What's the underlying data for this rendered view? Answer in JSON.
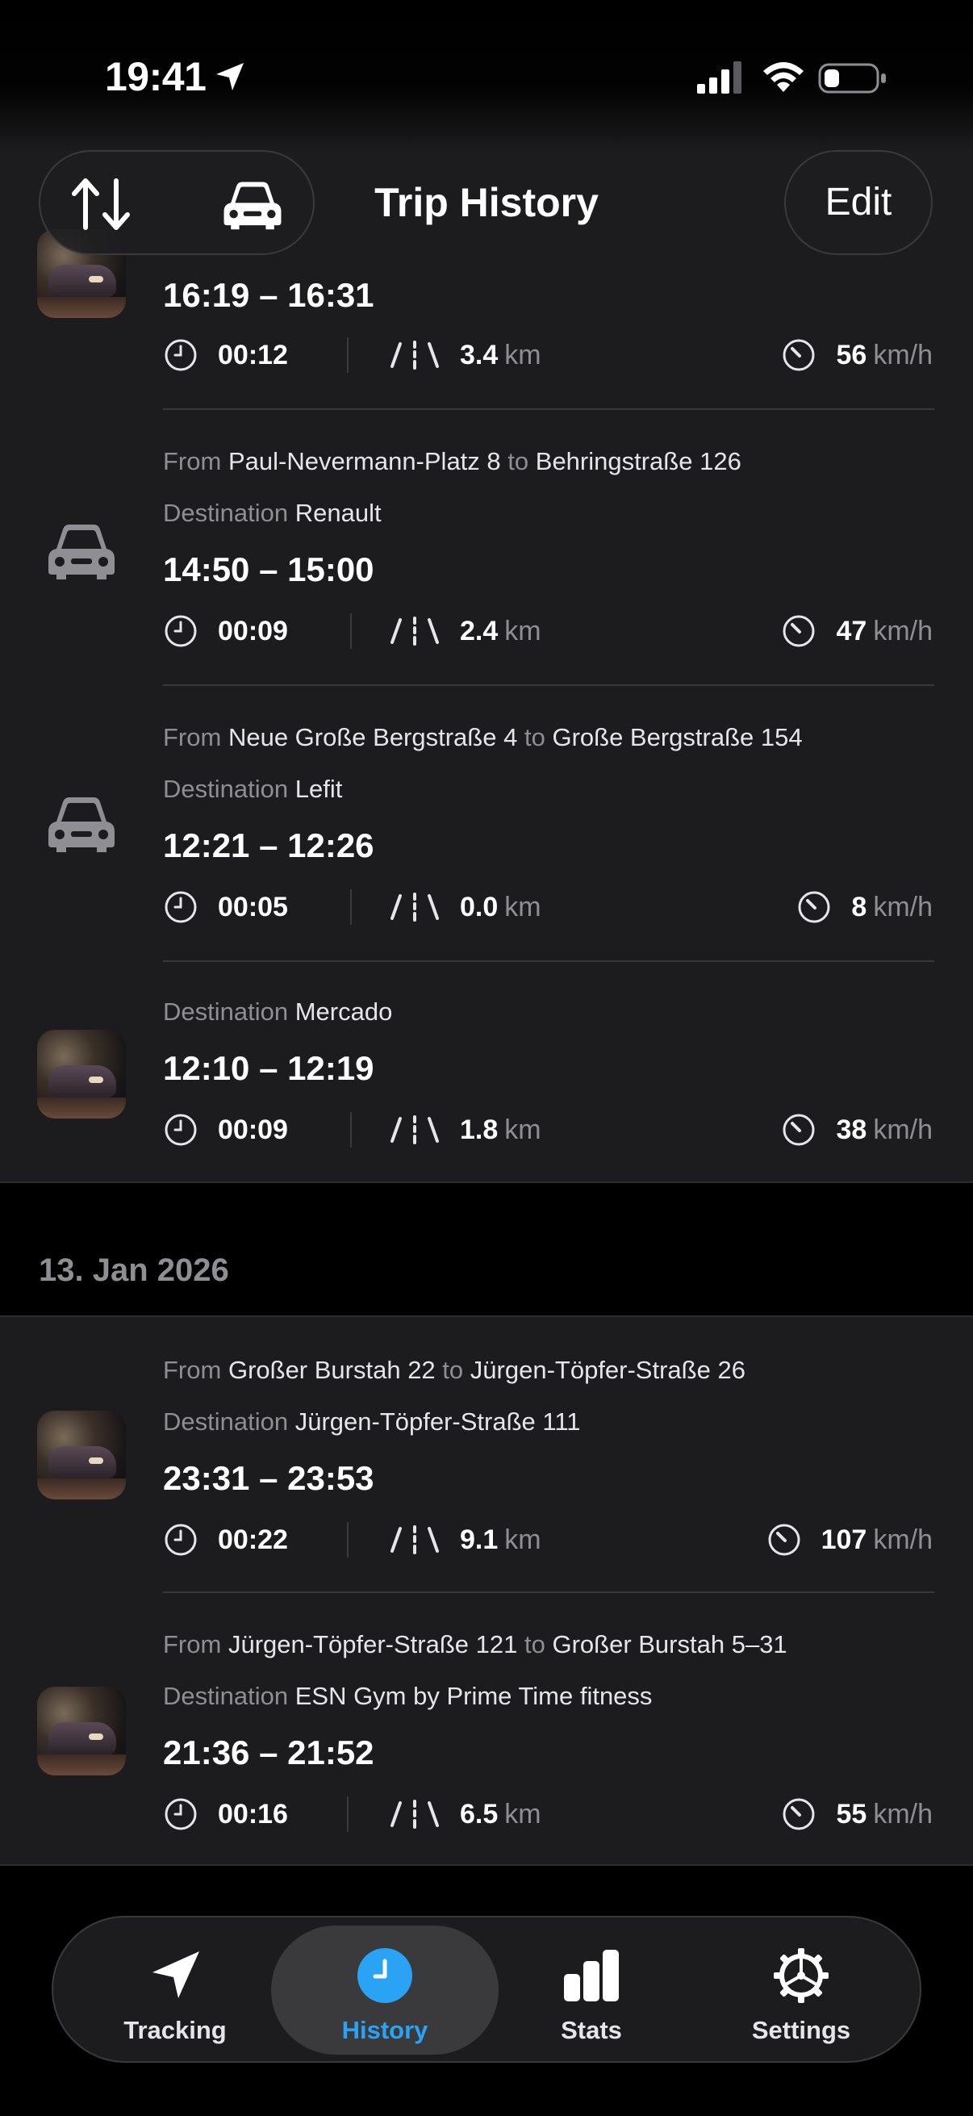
{
  "status_bar": {
    "time": "19:41"
  },
  "nav": {
    "title": "Trip History",
    "edit_label": "Edit"
  },
  "trips_section1": [
    {
      "icon": "car-photo",
      "time": "16:19 – 16:31",
      "duration": "00:12",
      "distance": "3.4",
      "distance_unit": "km",
      "speed": "56",
      "speed_unit": "km/h"
    },
    {
      "icon": "car-icon",
      "from_label": "From",
      "from": "Paul-Nevermann-Platz 8",
      "to_label": "to",
      "to": "Behringstraße 126",
      "dest_label": "Destination",
      "destination": "Renault",
      "time": "14:50 – 15:00",
      "duration": "00:09",
      "distance": "2.4",
      "distance_unit": "km",
      "speed": "47",
      "speed_unit": "km/h"
    },
    {
      "icon": "car-icon",
      "from_label": "From",
      "from": "Neue Große Bergstraße 4",
      "to_label": "to",
      "to": "Große Bergstraße 154",
      "dest_label": "Destination",
      "destination": "Lefit",
      "time": "12:21 – 12:26",
      "duration": "00:05",
      "distance": "0.0",
      "distance_unit": "km",
      "speed": "8",
      "speed_unit": "km/h"
    },
    {
      "icon": "car-photo",
      "dest_label": "Destination",
      "destination": "Mercado",
      "time": "12:10 – 12:19",
      "duration": "00:09",
      "distance": "1.8",
      "distance_unit": "km",
      "speed": "38",
      "speed_unit": "km/h"
    }
  ],
  "section2_date": "13. Jan 2026",
  "trips_section2": [
    {
      "icon": "car-photo",
      "from_label": "From",
      "from": "Großer Burstah 22",
      "to_label": "to",
      "to": "Jürgen-Töpfer-Straße 26",
      "dest_label": "Destination",
      "destination": "Jürgen-Töpfer-Straße 111",
      "time": "23:31 – 23:53",
      "duration": "00:22",
      "distance": "9.1",
      "distance_unit": "km",
      "speed": "107",
      "speed_unit": "km/h"
    },
    {
      "icon": "car-photo",
      "from_label": "From",
      "from": "Jürgen-Töpfer-Straße 121",
      "to_label": "to",
      "to": "Großer Burstah 5–31",
      "dest_label": "Destination",
      "destination": "ESN Gym by Prime Time fitness",
      "time": "21:36 – 21:52",
      "duration": "00:16",
      "distance": "6.5",
      "distance_unit": "km",
      "speed": "55",
      "speed_unit": "km/h"
    }
  ],
  "tabs": [
    {
      "label": "Tracking",
      "icon": "location-arrow-icon",
      "active": false
    },
    {
      "label": "History",
      "icon": "clock-icon",
      "active": true
    },
    {
      "label": "Stats",
      "icon": "bar-chart-icon",
      "active": false
    },
    {
      "label": "Settings",
      "icon": "gear-icon",
      "active": false
    }
  ],
  "colors": {
    "accent": "#2aa3f5",
    "background": "#000000",
    "card": "#1c1c1e",
    "secondary_text": "#8e8e93"
  }
}
